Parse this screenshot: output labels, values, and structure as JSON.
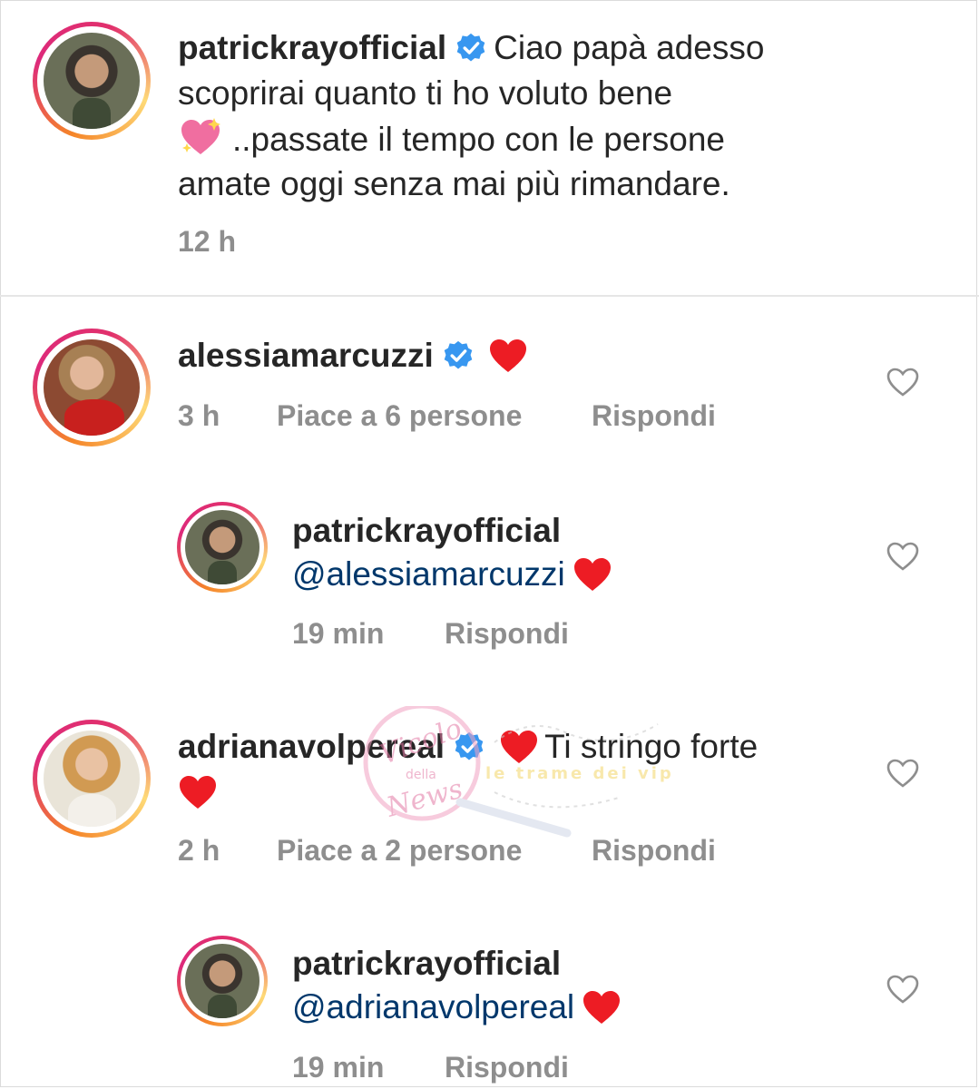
{
  "post": {
    "username": "patrickrayofficial",
    "caption_line1": "Ciao papà adesso",
    "caption_line2": "scoprirai quanto ti ho voluto bene",
    "caption_line3": "..passate il tempo con le persone",
    "caption_line4": "amate oggi senza mai più rimandare.",
    "time": "12 h"
  },
  "comments": [
    {
      "username": "alessiamarcuzzi",
      "time": "3 h",
      "likes": "Piace a 6 persone",
      "reply_label": "Rispondi"
    },
    {
      "username": "patrickrayofficial",
      "mention": "@alessiamarcuzzi",
      "time": "19 min",
      "reply_label": "Rispondi"
    },
    {
      "username": "adrianavolpereal",
      "text": "Ti stringo forte",
      "time": "2 h",
      "likes": "Piace a 2 persone",
      "reply_label": "Rispondi"
    },
    {
      "username": "patrickrayofficial",
      "mention": "@adrianavolpereal",
      "time": "19 min",
      "reply_label": "Rispondi"
    }
  ],
  "watermark": {
    "text": "Vicolo della News",
    "tagline": "le trame dei vip"
  },
  "colors": {
    "text": "#262626",
    "meta": "#8e8e8e",
    "mention": "#00376b",
    "verified": "#3897f0",
    "heart": "#ed1c24"
  },
  "icons": [
    "verified-badge-icon",
    "red-heart-emoji-icon",
    "sparkling-heart-emoji-icon",
    "like-heart-outline-icon"
  ]
}
